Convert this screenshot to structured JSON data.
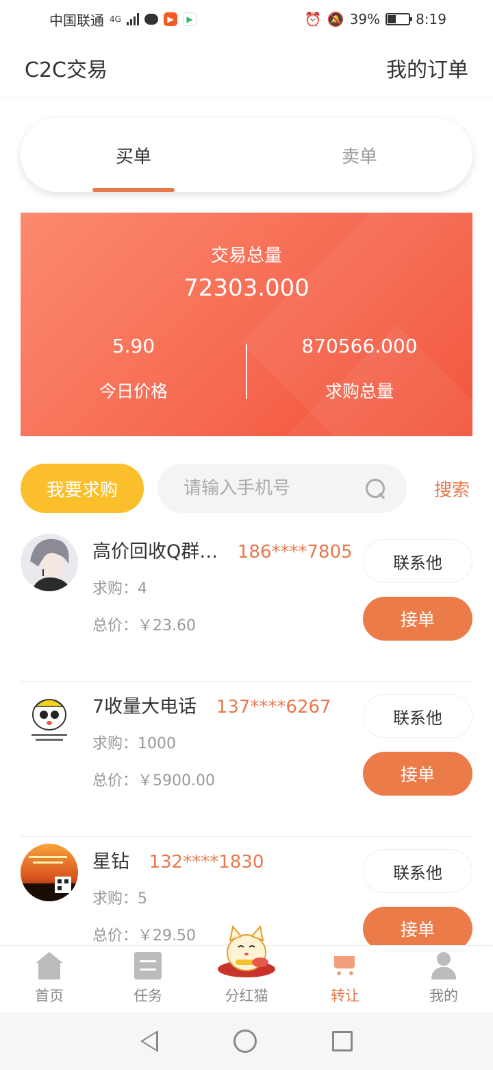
{
  "status_bar": {
    "carrier": "中国联通",
    "network": "4G",
    "battery": "39%",
    "battery_level": 0.39,
    "time": "8:19"
  },
  "header": {
    "title": "C2C交易",
    "my_orders": "我的订单"
  },
  "tabs": [
    {
      "label": "买单",
      "active": true
    },
    {
      "label": "卖单",
      "active": false
    }
  ],
  "stats": {
    "total_label": "交易总量",
    "total_value": "72303.000",
    "price_value": "5.90",
    "price_label": "今日价格",
    "demand_value": "870566.000",
    "demand_label": "求购总量"
  },
  "actions": {
    "request_label": "我要求购",
    "search_placeholder": "请输入手机号",
    "search_label": "搜索"
  },
  "orders": [
    {
      "name": "高价回收Q群…",
      "phone": "186****7805",
      "qty": "求购：4",
      "price": "总价：￥23.60",
      "contact": "联系他",
      "accept": "接单"
    },
    {
      "name": "7收量大电话",
      "phone": "137****6267",
      "qty": "求购：1000",
      "price": "总价：￥5900.00",
      "contact": "联系他",
      "accept": "接单"
    },
    {
      "name": "星钻",
      "phone": "132****1830",
      "qty": "求购：5",
      "price": "总价：￥29.50",
      "contact": "联系他",
      "accept": "接单"
    }
  ],
  "bottom_nav": [
    {
      "label": "首页",
      "icon": "home-icon"
    },
    {
      "label": "任务",
      "icon": "task-icon"
    },
    {
      "label": "分红猫",
      "icon": "lucky-cat-icon"
    },
    {
      "label": "转让",
      "icon": "cart-icon",
      "active": true
    },
    {
      "label": "我的",
      "icon": "user-icon"
    }
  ],
  "colors": {
    "accent": "#e8784a",
    "request_button": "#fbbf2b",
    "card_gradient_start": "#fb8a6e",
    "card_gradient_end": "#f24b30"
  }
}
